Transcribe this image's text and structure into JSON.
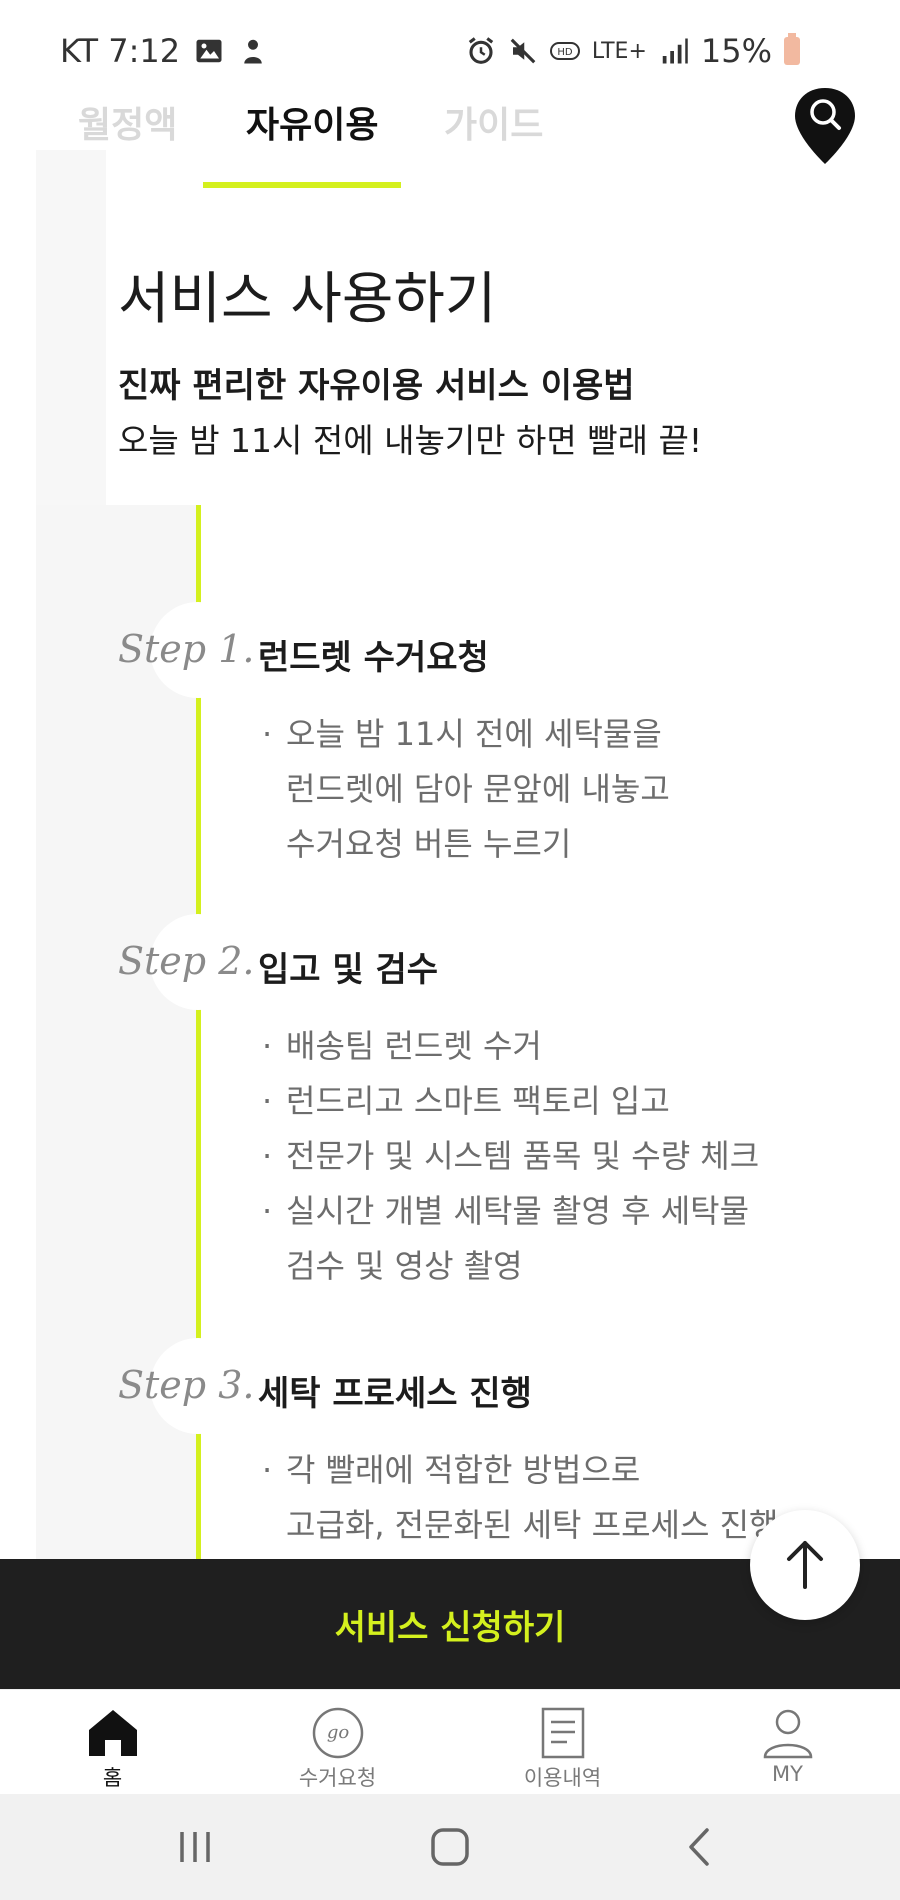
{
  "status_bar": {
    "carrier_time": "KT 7:12",
    "network": "LTE+",
    "battery": "15%",
    "icons_left": [
      "image-icon",
      "person-notification-icon"
    ],
    "icons_right": [
      "alarm-icon",
      "mute-icon",
      "hd-voice-icon",
      "lte-icon",
      "signal-icon",
      "battery-icon"
    ]
  },
  "tabs": [
    {
      "label": "월정액",
      "active": false
    },
    {
      "label": "자유이용",
      "active": true
    },
    {
      "label": "가이드",
      "active": false
    }
  ],
  "accent_color": "#d4f01e",
  "header": {
    "title": "서비스 사용하기",
    "subtitle": "진짜 편리한 자유이용 서비스 이용법",
    "description": "오늘 밤 11시 전에 내놓기만 하면 빨래 끝!"
  },
  "steps": [
    {
      "label": "Step 1.",
      "title": "런드렛 수거요청",
      "lines": [
        {
          "bullet": true,
          "text": "오늘 밤 11시 전에 세탁물을"
        },
        {
          "bullet": false,
          "text": "런드렛에 담아 문앞에 내놓고"
        },
        {
          "bullet": false,
          "text": "수거요청 버튼 누르기"
        }
      ]
    },
    {
      "label": "Step 2.",
      "title": "입고 및 검수",
      "lines": [
        {
          "bullet": true,
          "text": "배송팀 런드렛 수거"
        },
        {
          "bullet": true,
          "text": "런드리고 스마트 팩토리 입고"
        },
        {
          "bullet": true,
          "text": "전문가 및 시스템 품목 및 수량 체크"
        },
        {
          "bullet": true,
          "text": "실시간 개별 세탁물 촬영 후 세탁물"
        },
        {
          "bullet": false,
          "text": "검수 및 영상 촬영"
        }
      ]
    },
    {
      "label": "Step 3.",
      "title": "세탁 프로세스 진행",
      "lines": [
        {
          "bullet": true,
          "text": "각 빨래에 적합한 방법으로"
        },
        {
          "bullet": false,
          "text": "고급화, 전문화된 세탁 프로세스 진행"
        }
      ]
    }
  ],
  "apply_button": {
    "label": "서비스 신청하기"
  },
  "bottom_nav": [
    {
      "label": "홈",
      "icon": "home-icon",
      "active": true
    },
    {
      "label": "수거요청",
      "icon": "go-icon",
      "active": false
    },
    {
      "label": "이용내역",
      "icon": "document-icon",
      "active": false
    },
    {
      "label": "MY",
      "icon": "person-icon",
      "active": false
    }
  ],
  "system_nav": [
    "recent-apps-icon",
    "home-button-icon",
    "back-icon"
  ]
}
